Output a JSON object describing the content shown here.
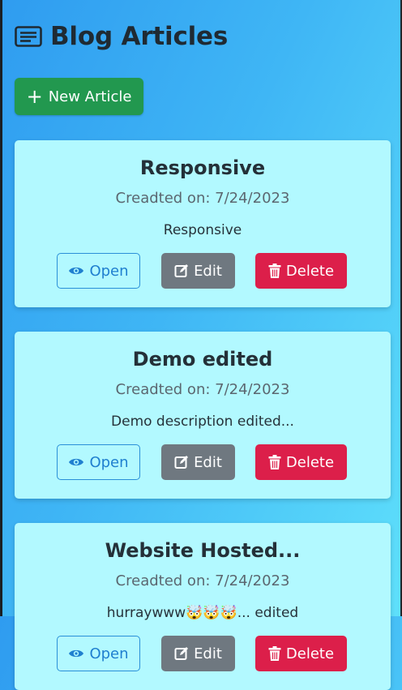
{
  "header": {
    "title": "Blog Articles",
    "icon": "article-icon"
  },
  "toolbar": {
    "new_label": "New Article"
  },
  "articles": [
    {
      "title": "Responsive",
      "date": "Creadted on: 7/24/2023",
      "description": "Responsive",
      "open_label": "Open",
      "edit_label": "Edit",
      "delete_label": "Delete"
    },
    {
      "title": "Demo edited",
      "date": "Creadted on: 7/24/2023",
      "description": "Demo description edited...",
      "open_label": "Open",
      "edit_label": "Edit",
      "delete_label": "Delete"
    },
    {
      "title": "Website Hosted...",
      "date": "Creadted on: 7/24/2023",
      "description": "hurraywww🤯🤯🤯... edited",
      "open_label": "Open",
      "edit_label": "Edit",
      "delete_label": "Delete"
    }
  ],
  "colors": {
    "new_button": "#22984f",
    "edit_button": "#6f7880",
    "delete_button": "#dc1f4a",
    "open_outline": "#2a8fd8",
    "card_bg": "#b2f9ff"
  }
}
